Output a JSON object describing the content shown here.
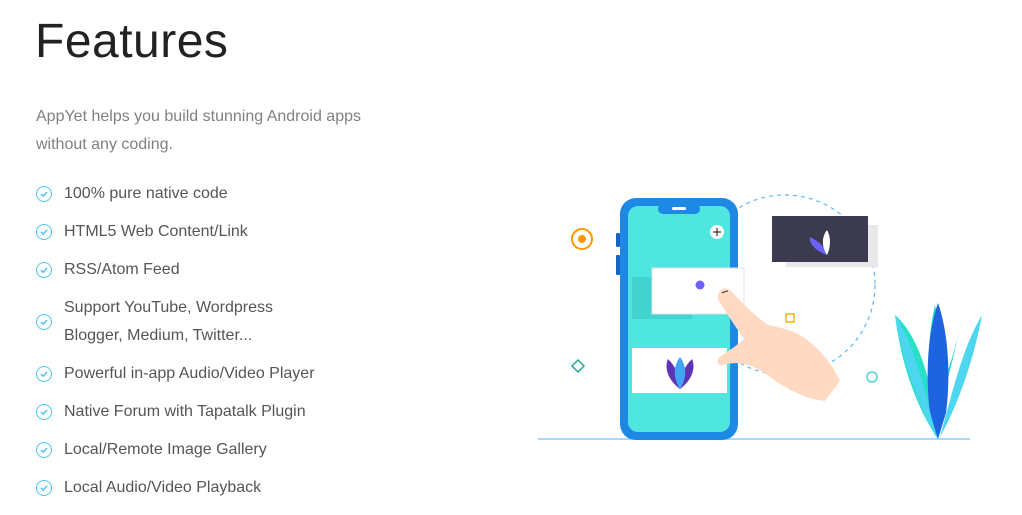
{
  "page": {
    "title": "Features",
    "intro": "AppYet helps you build stunning Android apps without any coding."
  },
  "features": [
    {
      "line1": "100% pure native code",
      "line2": ""
    },
    {
      "line1": "HTML5 Web Content/Link",
      "line2": ""
    },
    {
      "line1": "RSS/Atom Feed",
      "line2": ""
    },
    {
      "line1": "Support YouTube, Wordpress",
      "line2": "Blogger, Medium, Twitter..."
    },
    {
      "line1": "Powerful in-app Audio/Video Player",
      "line2": ""
    },
    {
      "line1": "Native Forum with Tapatalk Plugin",
      "line2": ""
    },
    {
      "line1": "Local/Remote Image Gallery",
      "line2": ""
    },
    {
      "line1": "Local Audio/Video Playback",
      "line2": ""
    }
  ],
  "icons": {
    "feature_icon": "check-circle-icon",
    "illustration": "phone-hand-illustration"
  },
  "colors": {
    "accent": "#4fc3f7",
    "title": "#222222",
    "text": "#555555",
    "muted": "#808080",
    "phone": "#1e88e5",
    "screen": "#4fe6e0",
    "lotus": "#6c63ff"
  }
}
